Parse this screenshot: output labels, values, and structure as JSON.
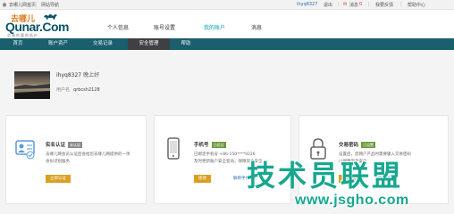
{
  "topbar": {
    "home_label": "去哪儿网首页",
    "app_label": "网站导航",
    "user": "ihyq8327",
    "logout": "退出",
    "messages": "消息",
    "messages_count": "0",
    "feedback": "我要反馈",
    "help": "帮助中心"
  },
  "header": {
    "logo_cn": "去哪儿",
    "logo_en": "Qunar.Com",
    "logo_sub": "总有你要的低价",
    "nav": [
      {
        "label": "个人信息"
      },
      {
        "label": "账号设置"
      },
      {
        "label": "我的账户"
      },
      {
        "label": "消息"
      }
    ]
  },
  "subnav": {
    "tabs": [
      {
        "label": "首页"
      },
      {
        "label": "账户资产"
      },
      {
        "label": "交易记录"
      },
      {
        "label": "安全管理"
      },
      {
        "label": "帮助"
      }
    ]
  },
  "profile": {
    "name": "ihyq8327",
    "greeting": "晚上好",
    "user_id_label": "用户名",
    "user_id": "qrbcsh2128"
  },
  "cards": [
    {
      "title": "实名认证",
      "badge": "未认证",
      "desc": [
        "去哪儿网会员认证后会给您去哪儿网提供的一项",
        "身份识别服务"
      ],
      "button": "立即认证",
      "link": ""
    },
    {
      "title": "手机号",
      "badge": "已验证",
      "desc": [
        "已绑定手机号 +86-150****9226",
        "及时更新账户安全变动，保障资金安全"
      ],
      "button": "修改",
      "link": "解绑手机"
    },
    {
      "title": "交易密码",
      "badge": "已设置",
      "desc": [
        "设置后，您网户产品时需要输入交易密码",
        "以保障资金安全"
      ],
      "button": "修改",
      "link": "忘记密码"
    }
  ],
  "watermark": {
    "cn": "技术员联盟",
    "url": "www.jsgho.com"
  },
  "colors": {
    "accent": "#0aa0b0",
    "subnav_bg": "#1a5f6e",
    "subnav_active": "#3e4044",
    "button": "#d9a021",
    "watermark": "#17a78f"
  }
}
